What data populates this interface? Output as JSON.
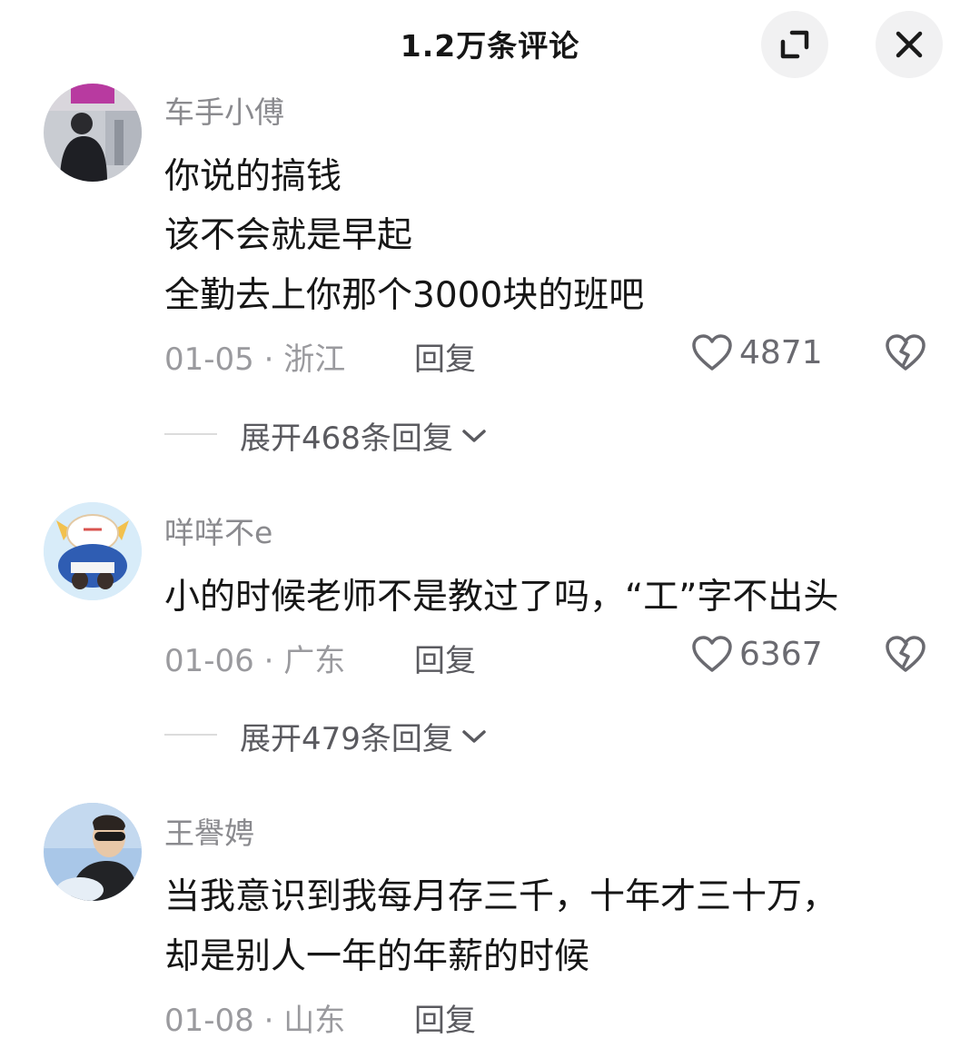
{
  "header": {
    "title": "1.2万条评论"
  },
  "comments": [
    {
      "username": "车手小傅",
      "lines": [
        "你说的搞钱",
        "该不会就是早起",
        "全勤去上你那个3000块的班吧"
      ],
      "date": "01-05",
      "location": "浙江",
      "meta": "01-05 · 浙江",
      "reply_label": "回复",
      "likes": "4871",
      "expand_label": "展开468条回复"
    },
    {
      "username": "咩咩不e",
      "lines": [
        "小的时候老师不是教过了吗，“工”字不出头"
      ],
      "date": "01-06",
      "location": "广东",
      "meta": "01-06 · 广东",
      "reply_label": "回复",
      "likes": "6367",
      "expand_label": "展开479条回复"
    },
    {
      "username": "王譽娉",
      "lines": [
        "当我意识到我每月存三千，十年才三十万，",
        "却是别人一年的年薪的时候"
      ],
      "date": "01-08",
      "location": "山东",
      "meta": "01-08 · 山东",
      "reply_label": "回复"
    }
  ],
  "icons": {
    "expand": "expand-icon",
    "close": "close-icon",
    "like": "heart-icon",
    "dislike": "broken-heart-icon",
    "chevron": "chevron-down-icon"
  },
  "colors": {
    "username": "#8a8a8e",
    "text": "#161616",
    "meta": "#9a9a9e",
    "button_bg": "#f1f1f2"
  }
}
